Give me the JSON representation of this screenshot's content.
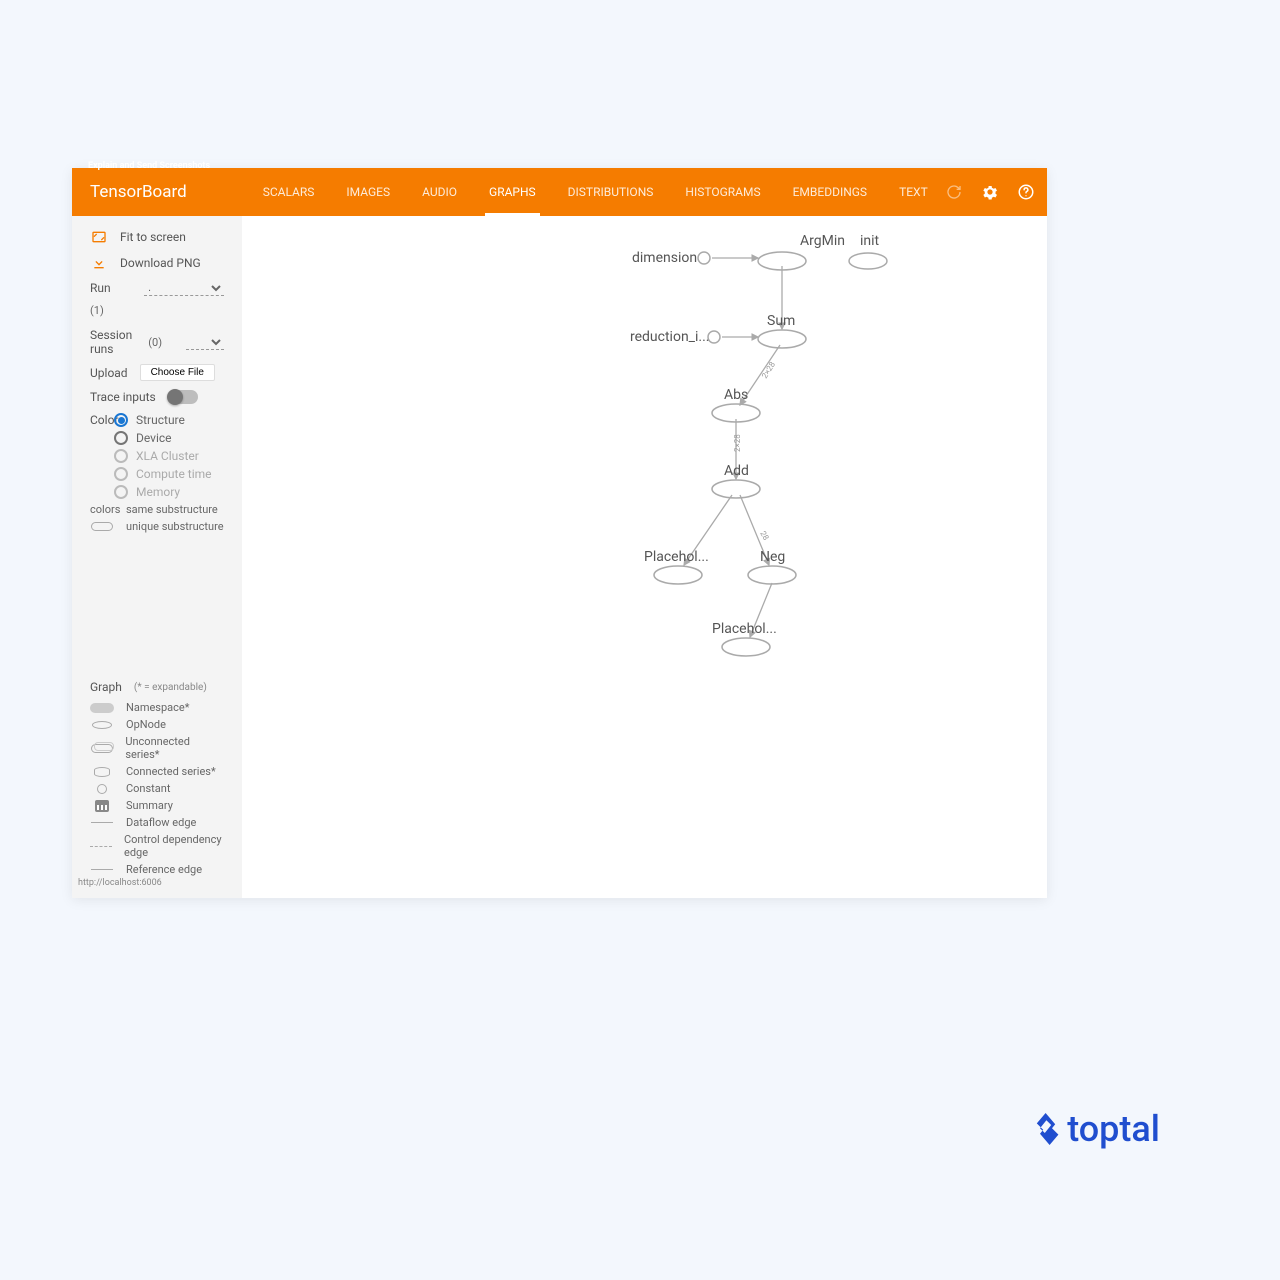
{
  "header": {
    "pre_title": "Explain and Send Screenshots",
    "app_title": "TensorBoard",
    "tabs": [
      {
        "label": "SCALARS",
        "active": false
      },
      {
        "label": "IMAGES",
        "active": false
      },
      {
        "label": "AUDIO",
        "active": false
      },
      {
        "label": "GRAPHS",
        "active": true
      },
      {
        "label": "DISTRIBUTIONS",
        "active": false
      },
      {
        "label": "HISTOGRAMS",
        "active": false
      },
      {
        "label": "EMBEDDINGS",
        "active": false
      },
      {
        "label": "TEXT",
        "active": false
      }
    ],
    "icons": [
      "refresh-icon",
      "gear-icon",
      "help-icon"
    ]
  },
  "sidebar": {
    "fit_label": "Fit to screen",
    "download_label": "Download PNG",
    "run": {
      "label": "Run",
      "value": ".",
      "count": "(1)"
    },
    "session": {
      "label": "Session runs",
      "count": "(0)"
    },
    "upload": {
      "label": "Upload",
      "button": "Choose File"
    },
    "trace_label": "Trace inputs",
    "color_label": "Color",
    "color_options": [
      {
        "label": "Structure",
        "checked": true,
        "disabled": false
      },
      {
        "label": "Device",
        "checked": false,
        "disabled": false
      },
      {
        "label": "XLA Cluster",
        "checked": false,
        "disabled": true
      },
      {
        "label": "Compute time",
        "checked": false,
        "disabled": true
      },
      {
        "label": "Memory",
        "checked": false,
        "disabled": true
      }
    ],
    "colors_legend_label": "colors",
    "colors_legend": [
      {
        "shape": "shape-rr",
        "label": "same substructure"
      },
      {
        "shape": "shape-rr-outline",
        "label": "unique substructure"
      }
    ],
    "graph_label": "Graph",
    "graph_hint": "(* = expandable)",
    "graph_legend": [
      {
        "shape": "shape-rr",
        "label": "Namespace*"
      },
      {
        "shape": "shape-ellipse",
        "label": "OpNode"
      },
      {
        "shape": "shape-series",
        "label": "Unconnected series*"
      },
      {
        "shape": "shape-db",
        "label": "Connected series*"
      },
      {
        "shape": "shape-circle",
        "label": "Constant"
      },
      {
        "shape": "shape-summary",
        "label": "Summary"
      },
      {
        "shape": "shape-line",
        "label": "Dataflow edge"
      },
      {
        "shape": "shape-dashed",
        "label": "Control dependency edge"
      },
      {
        "shape": "shape-arrow",
        "label": "Reference edge"
      }
    ],
    "footer_url": "http://localhost:6006"
  },
  "graph": {
    "nodes": {
      "argmin": "ArgMin",
      "init": "init",
      "dimension": "dimension",
      "sum": "Sum",
      "reduction": "reduction_i...",
      "abs": "Abs",
      "add": "Add",
      "placehol1": "Placehol...",
      "neg": "Neg",
      "placehol2": "Placehol..."
    },
    "edge_labels": {
      "e1": "2×28",
      "e2": "2×28",
      "e3": "28"
    }
  },
  "footer": {
    "brand": "toptal"
  }
}
